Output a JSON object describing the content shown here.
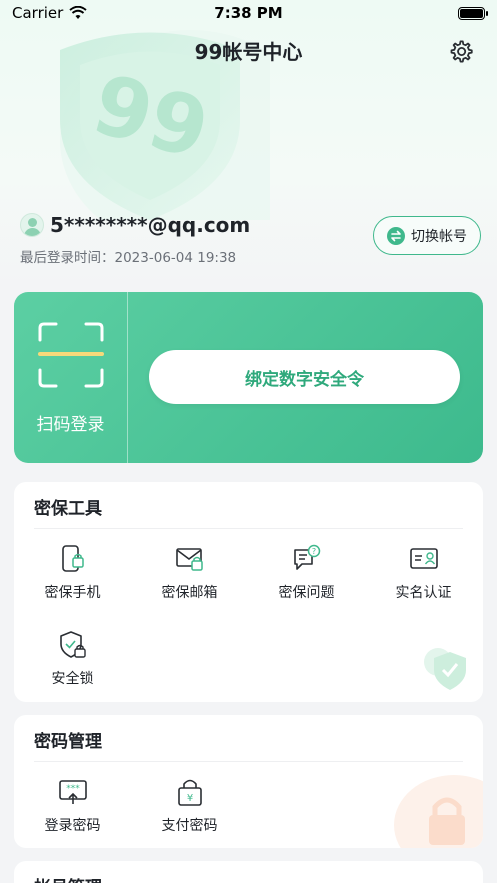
{
  "status_bar": {
    "carrier": "Carrier",
    "time": "7:38 PM"
  },
  "header": {
    "title": "99帐号中心",
    "settings_icon": "gear-icon"
  },
  "user": {
    "email": "5********@qq.com",
    "last_login": "最后登录时间：2023-06-04 19:38",
    "switch_label": "切换帐号"
  },
  "promo": {
    "scan_label": "扫码登录",
    "bind_label": "绑定数字安全令"
  },
  "security_tools": {
    "title": "密保工具",
    "items": [
      {
        "label": "密保手机",
        "icon": "phone-lock-icon"
      },
      {
        "label": "密保邮箱",
        "icon": "mail-lock-icon"
      },
      {
        "label": "密保问题",
        "icon": "question-chat-icon"
      },
      {
        "label": "实名认证",
        "icon": "id-card-icon"
      },
      {
        "label": "安全锁",
        "icon": "shield-lock-icon"
      }
    ]
  },
  "password_management": {
    "title": "密码管理",
    "items": [
      {
        "label": "登录密码",
        "icon": "login-password-icon"
      },
      {
        "label": "支付密码",
        "icon": "payment-lock-icon"
      }
    ]
  },
  "account_management": {
    "title": "帐号管理"
  },
  "colors": {
    "accent": "#3fb88c",
    "accent_light": "#5ccfa3",
    "background": "#f3f4f6"
  }
}
